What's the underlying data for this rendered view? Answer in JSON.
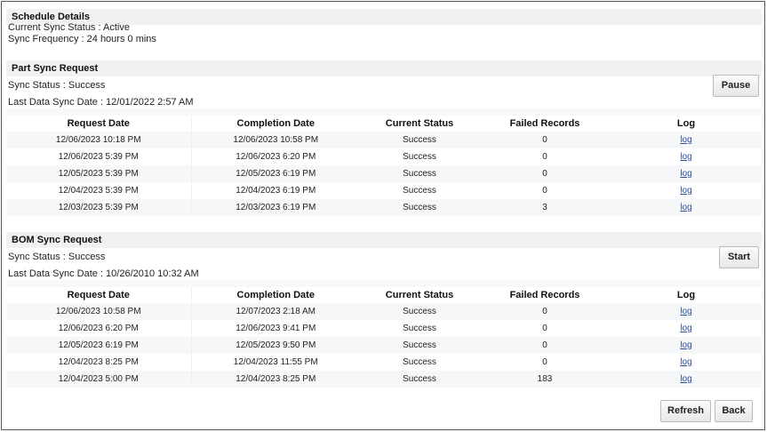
{
  "schedule": {
    "heading": "Schedule Details",
    "status_line": "Current Sync Status : Active",
    "frequency_line": "Sync Frequency : 24 hours 0 mins"
  },
  "columns": [
    "Request Date",
    "Completion Date",
    "Current Status",
    "Failed Records",
    "Log"
  ],
  "part_sync": {
    "heading": "Part Sync Request",
    "status_line": "Sync Status : Success",
    "last_sync_line": "Last Data Sync Date : 12/01/2022 2:57 AM",
    "button_label": "Pause",
    "rows": [
      {
        "request": "12/06/2023 10:18 PM",
        "completion": "12/06/2023 10:58 PM",
        "status": "Success",
        "failed": "0",
        "log": "log"
      },
      {
        "request": "12/06/2023 5:39 PM",
        "completion": "12/06/2023 6:20 PM",
        "status": "Success",
        "failed": "0",
        "log": "log"
      },
      {
        "request": "12/05/2023 5:39 PM",
        "completion": "12/05/2023 6:19 PM",
        "status": "Success",
        "failed": "0",
        "log": "log"
      },
      {
        "request": "12/04/2023 5:39 PM",
        "completion": "12/04/2023 6:19 PM",
        "status": "Success",
        "failed": "0",
        "log": "log"
      },
      {
        "request": "12/03/2023 5:39 PM",
        "completion": "12/03/2023 6:19 PM",
        "status": "Success",
        "failed": "3",
        "log": "log"
      }
    ]
  },
  "bom_sync": {
    "heading": "BOM Sync Request",
    "status_line": "Sync Status : Success",
    "last_sync_line": "Last Data Sync Date : 10/26/2010 10:32 AM",
    "button_label": "Start",
    "rows": [
      {
        "request": "12/06/2023 10:58 PM",
        "completion": "12/07/2023 2:18 AM",
        "status": "Success",
        "failed": "0",
        "log": "log"
      },
      {
        "request": "12/06/2023 6:20 PM",
        "completion": "12/06/2023 9:41 PM",
        "status": "Success",
        "failed": "0",
        "log": "log"
      },
      {
        "request": "12/05/2023 6:19 PM",
        "completion": "12/05/2023 9:50 PM",
        "status": "Success",
        "failed": "0",
        "log": "log"
      },
      {
        "request": "12/04/2023 8:25 PM",
        "completion": "12/04/2023 11:55 PM",
        "status": "Success",
        "failed": "0",
        "log": "log"
      },
      {
        "request": "12/04/2023 5:00 PM",
        "completion": "12/04/2023 8:25 PM",
        "status": "Success",
        "failed": "183",
        "log": "log"
      }
    ]
  },
  "footer": {
    "refresh_label": "Refresh",
    "back_label": "Back"
  }
}
